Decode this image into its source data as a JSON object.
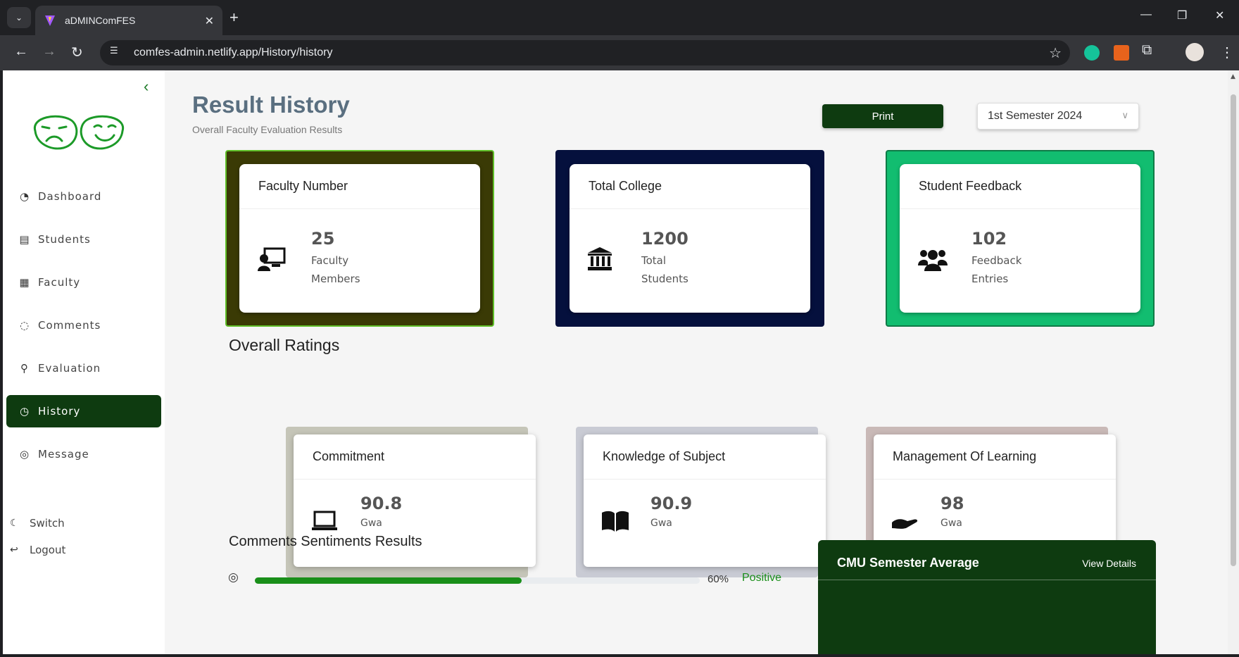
{
  "browser": {
    "tab_title": "aDMINComFES",
    "tab_close": "✕",
    "new_tab": "+",
    "url": "comfes-admin.netlify.app/History/history",
    "window_controls": [
      "—",
      "❐",
      "✕"
    ]
  },
  "sidebar": {
    "items": [
      {
        "label": "Dashboard",
        "icon": "dashboard-icon",
        "glyph": "◔"
      },
      {
        "label": "Students",
        "icon": "list-icon",
        "glyph": "▤"
      },
      {
        "label": "Faculty",
        "icon": "grid-icon",
        "glyph": "▦"
      },
      {
        "label": "Comments",
        "icon": "comment-icon",
        "glyph": "◌"
      },
      {
        "label": "Evaluation",
        "icon": "person-search-icon",
        "glyph": "⚲"
      },
      {
        "label": "History",
        "icon": "history-icon",
        "glyph": "◷",
        "active": true
      },
      {
        "label": "Message",
        "icon": "chat-icon",
        "glyph": "◎"
      }
    ],
    "switch_label": "Switch",
    "logout_label": "Logout"
  },
  "header": {
    "title": "Result History",
    "subtitle": "Overall Faculty Evaluation Results",
    "print_label": "Print",
    "semester_value": "1st Semester 2024"
  },
  "stats": [
    {
      "title": "Faculty Number",
      "value": "25",
      "label": "Faculty Members",
      "icon": "teacher-board-icon",
      "frame_color": "#3a3a05",
      "border_color": "#5fbf28"
    },
    {
      "title": "Total College",
      "value": "1200",
      "label": "Total Students",
      "icon": "institution-icon",
      "frame_color": "#05103d",
      "border_color": "#05103d"
    },
    {
      "title": "Student Feedback",
      "value": "102",
      "label": "Feedback Entries",
      "icon": "users-icon",
      "frame_color": "#12bd70",
      "border_color": "#0f7b47"
    }
  ],
  "ratings_section_title": "Overall Ratings",
  "ratings": [
    {
      "title": "Commitment",
      "value": "90.8",
      "unit": "Gwa",
      "icon": "laptop-icon",
      "frame_color": "#c5c5b8"
    },
    {
      "title": "Knowledge of Subject",
      "value": "90.9",
      "unit": "Gwa",
      "icon": "book-icon",
      "frame_color": "#c9cbd4"
    },
    {
      "title": "Management Of Learning",
      "value": "98",
      "unit": "Gwa",
      "icon": "hand-holding-icon",
      "frame_color": "#c9b9b7"
    }
  ],
  "sentiment": {
    "title": "Comments Sentiments Results",
    "rows": [
      {
        "percent_value": 60,
        "percent_label": "60%",
        "class_label": "Positive"
      }
    ]
  },
  "average_card": {
    "title": "CMU Semester Average",
    "link": "View Details"
  },
  "colors": {
    "primary_dark_green": "#0e3b10",
    "progress_green": "#1a8f1a",
    "logo_green": "#1c9a28"
  }
}
